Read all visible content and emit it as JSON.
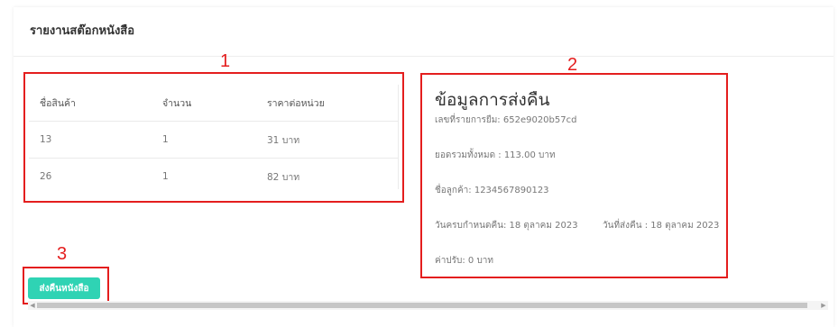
{
  "report": {
    "title": "รายงานสต๊อกหนังสือ"
  },
  "annotations": {
    "one": "1",
    "two": "2",
    "three": "3",
    "color": "#e41e1e"
  },
  "table": {
    "headers": [
      "ชื่อสินค้า",
      "จำนวน",
      "ราคาต่อหน่วย"
    ],
    "rows": [
      [
        "13",
        "1",
        "31 บาท"
      ],
      [
        "26",
        "1",
        "82 บาท"
      ]
    ]
  },
  "return_info": {
    "title": "ข้อมูลการส่งคืน",
    "borrow_id": "เลขที่รายการยืม: 652e9020b57cd",
    "total": "ยอดรวมทั้งหมด : 113.00 บาท",
    "customer": "ชื่อลูกค้า: 1234567890123",
    "due_date": "วันครบกำหนดคืน: 18 ตุลาคม 2023",
    "return_date": "วันที่ส่งคืน : 18 ตุลาคม 2023",
    "fine": "ค่าปรับ: 0 บาท"
  },
  "actions": {
    "return_button": "ส่งคืนหนังสือ",
    "button_color": "#2fd3b4"
  },
  "scrollbar": {
    "left_icon": "chevron-left-icon",
    "right_icon": "chevron-right-icon"
  }
}
